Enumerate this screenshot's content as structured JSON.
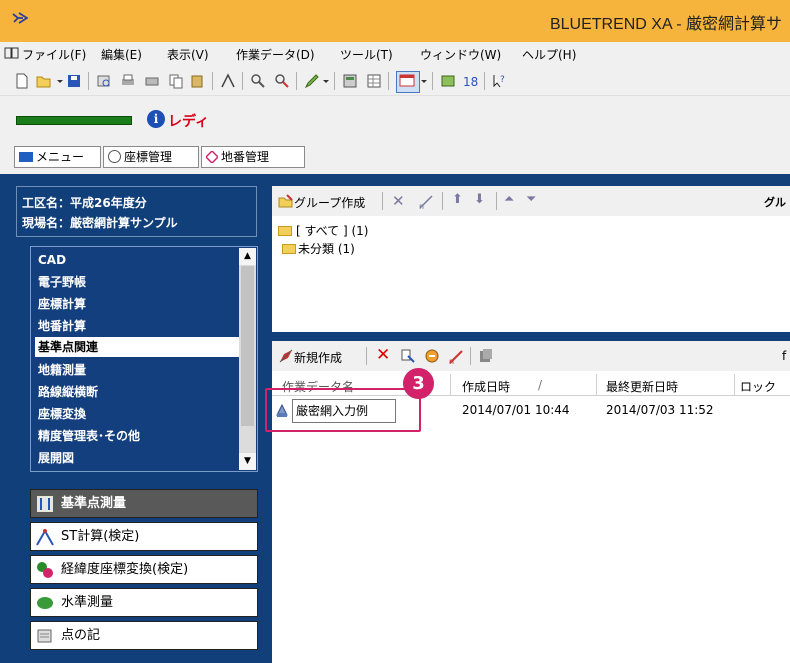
{
  "window": {
    "title": "BLUETREND XA - 厳密網計算サ"
  },
  "menubar": {
    "items": [
      "ファイル(F)",
      "編集(E)",
      "表示(V)",
      "作業データ(D)",
      "ツール(T)",
      "ウィンドウ(W)",
      "ヘルプ(H)"
    ]
  },
  "status": {
    "ready_label": "レディ",
    "ready_icon_glyph": "i"
  },
  "tabs": {
    "items": [
      "メニュー",
      "座標管理",
      "地番管理"
    ]
  },
  "site": {
    "district": "工区名：平成26年度分",
    "site_name": "現場名：厳密網計算サンプル"
  },
  "menu_list": {
    "items": [
      "CAD",
      "電子野帳",
      "座標計算",
      "地番計算",
      "基準点関連",
      "地籍測量",
      "路線縦横断",
      "座標変換",
      "精度管理表･その他",
      "展開図"
    ],
    "selected": "基準点関連"
  },
  "tools": {
    "items": [
      "基準点測量",
      "ST計算(検定)",
      "経緯度座標変換(検定)",
      "水準測量",
      "点の記"
    ],
    "selected": "基準点測量"
  },
  "group_panel": {
    "create_label": "グループ作成",
    "right_label": "グル",
    "folders": [
      "[ すべて ] (1)",
      "未分類 (1)"
    ]
  },
  "data_panel": {
    "new_label": "新規作成",
    "right_label": "f",
    "columns": [
      "作業データ名",
      "作成日時",
      "最終更新日時",
      "ロック"
    ],
    "sort_indicator": "/",
    "rows": [
      {
        "name": "厳密網入力例",
        "created": "2014/07/01 10:44",
        "updated": "2014/07/03 11:52",
        "lock": ""
      }
    ]
  },
  "callout": {
    "number": "3"
  },
  "colors": {
    "titlebar": "#f6b43c",
    "workspace": "#113f7a",
    "accent_magenta": "#d2236a",
    "ready_red": "#d9001b"
  }
}
